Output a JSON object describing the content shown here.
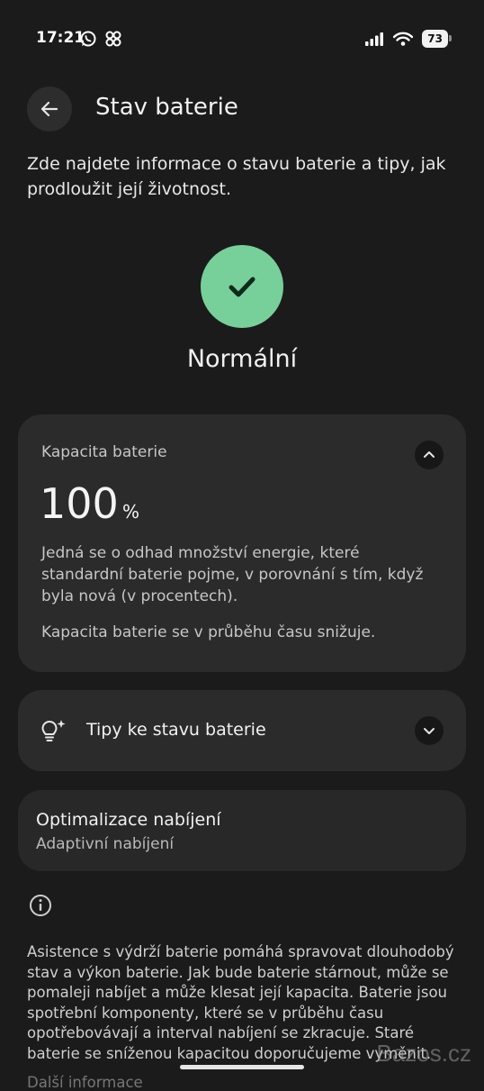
{
  "status_bar": {
    "time": "17:21",
    "left_icons": [
      "whatsapp-icon",
      "pinwheel-icon"
    ],
    "right_icons": [
      "cellular-signal-icon",
      "wifi-icon"
    ],
    "battery_level": "73"
  },
  "header": {
    "back_icon": "arrow-left-icon",
    "title": "Stav baterie"
  },
  "intro": "Zde najdete informace o stavu baterie a tipy, jak prodloužit její životnost.",
  "status": {
    "icon": "checkmark-icon",
    "color": "#77d09a",
    "label": "Normální"
  },
  "capacity_card": {
    "label": "Kapacita baterie",
    "value": "100",
    "unit": "%",
    "toggle_icon": "chevron-up-icon",
    "description": "Jedná se o odhad množství energie, které standardní baterie pojme, v porovnání s tím, když byla nová (v procentech).",
    "note": "Kapacita baterie se v průběhu času snižuje."
  },
  "tips_card": {
    "icon": "lightbulb-sparkle-icon",
    "label": "Tipy ke stavu baterie",
    "toggle_icon": "chevron-down-icon"
  },
  "optimization_card": {
    "title": "Optimalizace nabíjení",
    "subtitle": "Adaptivní nabíjení"
  },
  "info": {
    "icon": "info-icon",
    "text": "Asistence s výdrží baterie pomáhá spravovat dlouhodobý stav a výkon baterie. Jak bude baterie stárnout, může se pomaleji nabíjet a může klesat její kapacita. Baterie jsou spotřební komponenty, které se v průběhu času opotřebovávají a interval nabíjení se zkracuje. Staré baterie se sníženou kapacitou doporučujeme vyměnit.",
    "text_cut": "Další informace"
  },
  "watermark": "Bazos.cz"
}
